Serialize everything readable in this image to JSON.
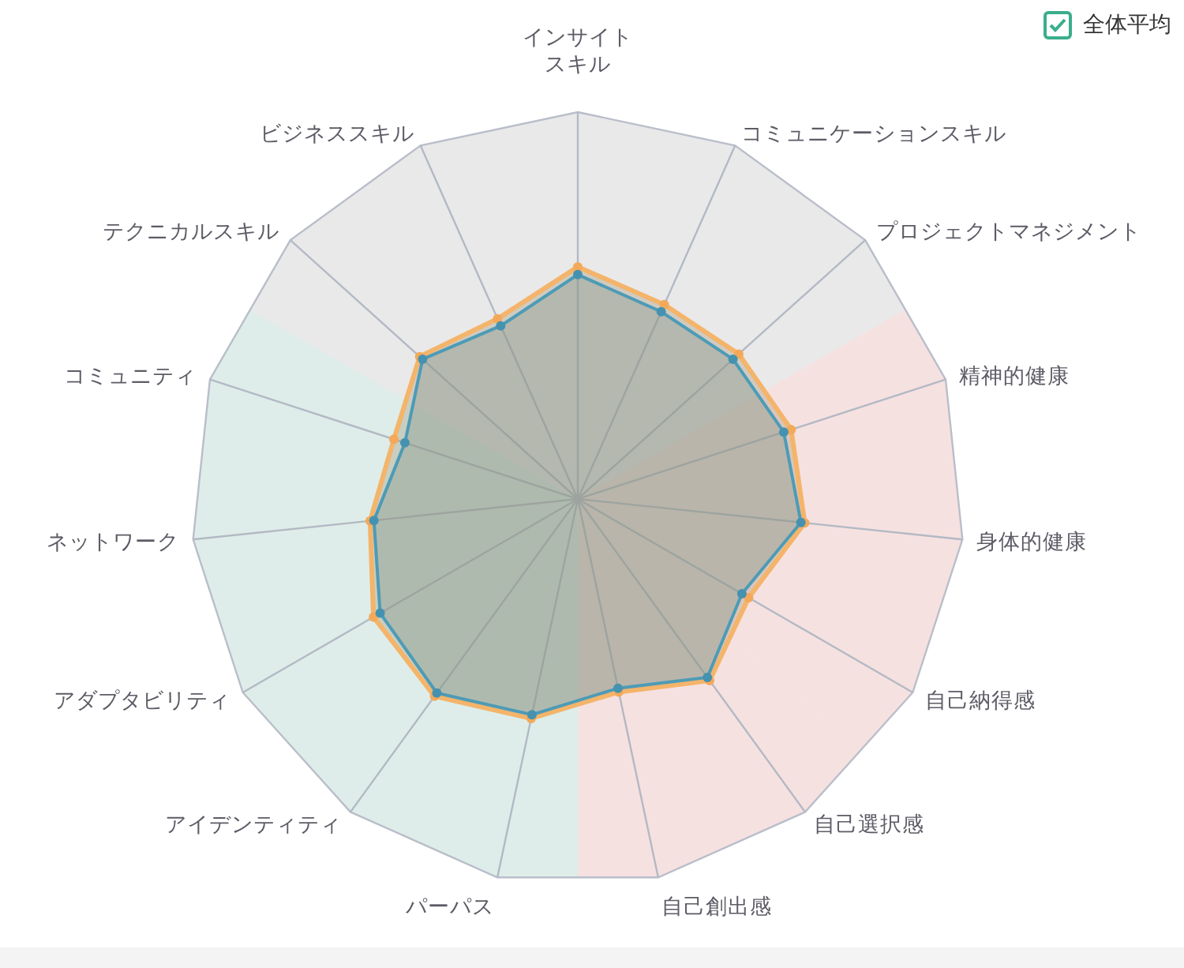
{
  "legend": {
    "label": "全体平均",
    "checked": true
  },
  "top": {
    "label": "インサイトスキル",
    "color": "#e9e9ea"
  },
  "left": [
    {
      "label": "ビジネススキル",
      "color": "#e9e9ea"
    },
    {
      "label": "テクニカルスキル",
      "color": "#e9e9ea"
    },
    {
      "label": "コミュニティ",
      "color": "#deede9"
    },
    {
      "label": "ネットワーク",
      "color": "#deede9"
    },
    {
      "label": "アダプタビリティ",
      "color": "#deede9"
    },
    {
      "label": "アイデンティティ",
      "color": "#deede9"
    },
    {
      "label": "パーパス",
      "color": "#deede9"
    }
  ],
  "right": [
    {
      "label": "コミュニケーションスキル",
      "color": "#e9e9ea"
    },
    {
      "label": "プロジェクトマネジメント",
      "color": "#e9e9ea"
    },
    {
      "label": "精神的健康",
      "color": "#f6e1e1"
    },
    {
      "label": "身体的健康",
      "color": "#f6e1e1"
    },
    {
      "label": "自己納得感",
      "color": "#f6e1e1"
    },
    {
      "label": "自己選択感",
      "color": "#f6e1e1"
    },
    {
      "label": "自己創出感",
      "color": "#f6e1e1"
    }
  ]
}
